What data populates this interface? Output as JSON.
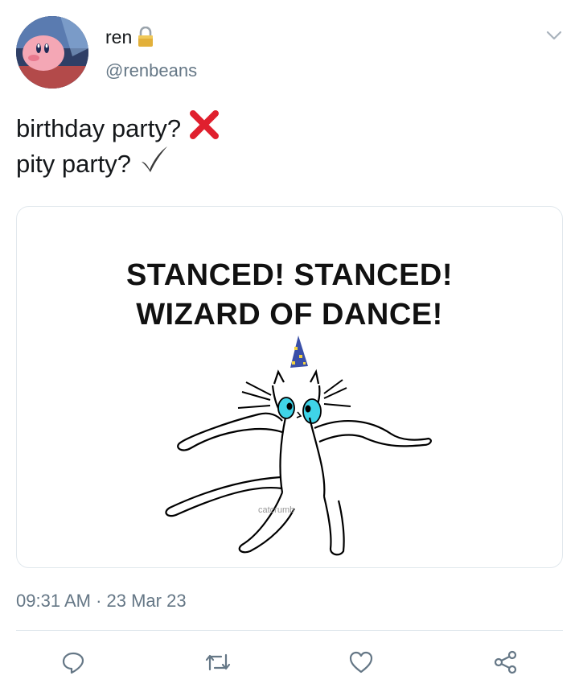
{
  "user": {
    "display_name": "ren",
    "handle": "@renbeans",
    "verified_lock": "lock-icon"
  },
  "tweet": {
    "line1": "birthday party?",
    "line1_emoji": "cross-mark-emoji",
    "line2": "pity party?",
    "line2_emoji": "check-mark-emoji"
  },
  "media": {
    "caption_line1": "STANCED! STANCED!",
    "caption_line2": "WIZARD OF DANCE!",
    "watermark": "catcrumb"
  },
  "meta": {
    "timestamp": "09:31 AM · 23 Mar 23"
  },
  "actions": [
    "reply-icon",
    "retweet-icon",
    "like-icon",
    "share-icon"
  ],
  "colors": {
    "text": "#14171a",
    "secondary": "#657786",
    "border": "#e1e8ed",
    "cross_red": "#e0202e",
    "check_gray": "#3a3a3a",
    "cat_eye": "#3fd4e8",
    "hat_blue": "#3a4fa8",
    "star_yellow": "#f2d240"
  }
}
